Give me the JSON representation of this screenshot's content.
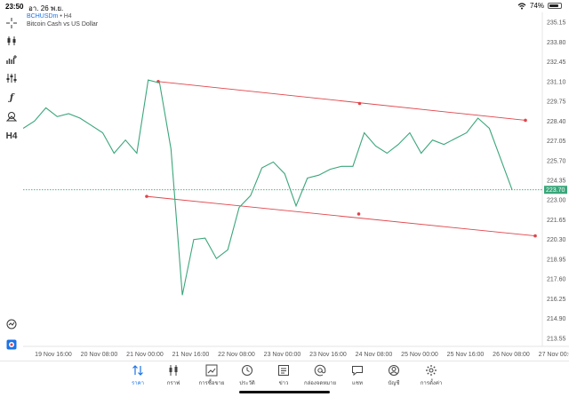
{
  "status": {
    "time": "23:50",
    "date": "อา. 26 พ.ย.",
    "battery": "74%",
    "battery_level": 0.74
  },
  "chart_header": {
    "symbol": "BCHUSDm",
    "timeframe": "• H4",
    "description": "Bitcoin Cash vs US Dollar"
  },
  "toolbar": {
    "items": [
      {
        "name": "crosshair-icon"
      },
      {
        "name": "candlestick-icon"
      },
      {
        "name": "indicator-add-icon"
      },
      {
        "name": "indicator-settings-icon"
      },
      {
        "name": "function-icon"
      },
      {
        "name": "objects-icon"
      },
      {
        "name": "timeframe-label",
        "label": "H4"
      }
    ],
    "bottom": [
      {
        "name": "quick-trade-icon"
      },
      {
        "name": "logo-icon"
      }
    ]
  },
  "price_axis": [
    "235.15",
    "233.80",
    "232.45",
    "231.10",
    "229.75",
    "228.40",
    "227.05",
    "225.70",
    "224.35",
    "223.00",
    "221.65",
    "220.30",
    "218.95",
    "217.60",
    "216.25",
    "214.90",
    "213.55"
  ],
  "current_price": "223.70",
  "time_axis": [
    "19 Nov 16:00",
    "20 Nov 08:00",
    "21 Nov 00:00",
    "21 Nov 16:00",
    "22 Nov 08:00",
    "23 Nov 00:00",
    "23 Nov 16:00",
    "24 Nov 08:00",
    "25 Nov 00:00",
    "25 Nov 16:00",
    "26 Nov 08:00",
    "27 Nov 00:00"
  ],
  "chart_data": {
    "type": "line",
    "series": [
      {
        "values": [
          227.9,
          228.4,
          229.3,
          228.7,
          228.9,
          228.6,
          228.1,
          227.6,
          226.2,
          227.1,
          226.2,
          231.2,
          231.0,
          226.5,
          216.5,
          220.3,
          220.4,
          219.0,
          219.6,
          222.5,
          223.3,
          225.2,
          225.6,
          224.8,
          222.6,
          224.5,
          224.7,
          225.1,
          225.3,
          225.3,
          227.6,
          226.7,
          226.2,
          226.8,
          227.6,
          226.2,
          227.1,
          226.8,
          227.2,
          227.6,
          228.6,
          227.9,
          225.8,
          223.7
        ]
      }
    ],
    "channel": [
      {
        "from": 231.1,
        "to": 228.45,
        "mid": 229.6
      },
      {
        "from": 223.25,
        "to": 220.55,
        "mid": 222.05
      }
    ],
    "ylim": [
      213.0,
      235.7
    ],
    "grid": false,
    "colors": {
      "line": "#3aa67a",
      "channel": "#e0454b",
      "current": "#3aa67a"
    }
  },
  "bottom_nav": [
    {
      "name": "nav-quotes",
      "label": "ราคา",
      "icon": "arrows-updown-icon",
      "active": true
    },
    {
      "name": "nav-chart",
      "label": "กราฟ",
      "icon": "candlestick-icon",
      "active": false
    },
    {
      "name": "nav-trade",
      "label": "การซื้อขาย",
      "icon": "chart-line-icon",
      "active": false
    },
    {
      "name": "nav-history",
      "label": "ประวัติ",
      "icon": "history-icon",
      "active": false
    },
    {
      "name": "nav-news",
      "label": "ข่าว",
      "icon": "news-icon",
      "active": false
    },
    {
      "name": "nav-mailbox",
      "label": "กล่องจดหมาย",
      "icon": "at-icon",
      "active": false
    },
    {
      "name": "nav-chat",
      "label": "แชท",
      "icon": "chat-icon",
      "active": false
    },
    {
      "name": "nav-accounts",
      "label": "บัญชี",
      "icon": "account-icon",
      "active": false
    },
    {
      "name": "nav-settings",
      "label": "การตั้งค่า",
      "icon": "gear-icon",
      "active": false
    }
  ]
}
